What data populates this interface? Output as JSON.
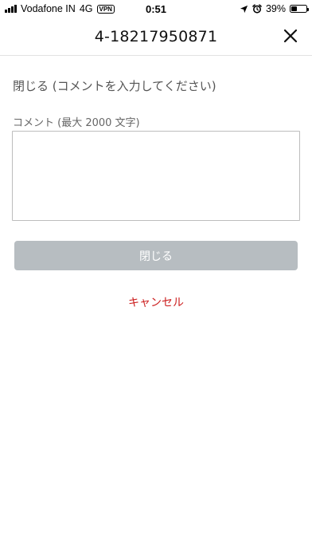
{
  "status_bar": {
    "carrier": "Vodafone IN",
    "network": "4G",
    "vpn": "VPN",
    "time": "0:51",
    "battery_percent": "39%",
    "battery_level": 0.39
  },
  "header": {
    "title": "4-18217950871"
  },
  "form": {
    "heading": "閉じる (コメントを入力してください)",
    "comment_label": "コメント (最大 2000 文字)",
    "comment_value": "",
    "submit_label": "閉じる",
    "cancel_label": "キャンセル"
  },
  "colors": {
    "submit_disabled_bg": "#b7bdc1",
    "cancel_text": "#cc1f1f"
  }
}
